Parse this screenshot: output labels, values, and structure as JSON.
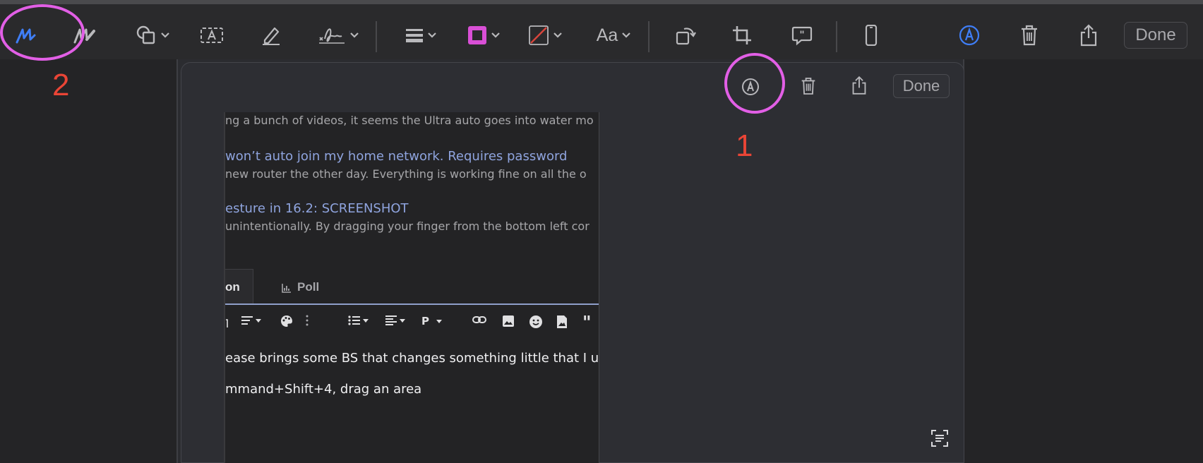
{
  "toolbar": {
    "done_label": "Done",
    "tools": [
      {
        "name": "sketch-tool",
        "icon": "sketch-icon",
        "active": true
      },
      {
        "name": "draw-tool",
        "icon": "draw-icon"
      },
      {
        "name": "shapes-tool",
        "icon": "shapes-icon"
      },
      {
        "name": "text-tool",
        "icon": "text-box-icon"
      },
      {
        "name": "highlight-tool",
        "icon": "highlighter-icon"
      },
      {
        "name": "sign-tool",
        "icon": "signature-icon"
      },
      {
        "name": "shape-style-tool",
        "icon": "line-weight-icon"
      },
      {
        "name": "border-color-tool",
        "icon": "border-color-icon",
        "color": "#d94fd6"
      },
      {
        "name": "fill-color-tool",
        "icon": "fill-color-icon",
        "color": "#d8453c"
      },
      {
        "name": "text-style-tool",
        "icon": "text-style-icon",
        "label": "Aa"
      },
      {
        "name": "rotate-tool",
        "icon": "rotate-icon"
      },
      {
        "name": "crop-tool",
        "icon": "crop-icon"
      },
      {
        "name": "description-tool",
        "icon": "quote-bubble-icon"
      },
      {
        "name": "device-frame-tool",
        "icon": "phone-icon"
      },
      {
        "name": "markup-button",
        "icon": "markup-pen-icon",
        "color": "#3f7ef6"
      },
      {
        "name": "trash-button",
        "icon": "trash-icon"
      },
      {
        "name": "share-button",
        "icon": "share-icon"
      }
    ]
  },
  "annotations": {
    "label_1": "1",
    "label_2": "2",
    "ring_color": "#e25fe6",
    "number_color": "#ea4536"
  },
  "inner": {
    "done_label": "Done",
    "snippets": [
      {
        "text": "ng a bunch of videos, it seems the Ultra auto goes into water mo",
        "kind": "snippet"
      },
      {
        "text": " won’t auto join my home network. Requires password",
        "kind": "link"
      },
      {
        "text": "new router the other day. Everything is working fine on all the o",
        "kind": "snippet"
      },
      {
        "text": "esture in 16.2: SCREENSHOT",
        "kind": "link"
      },
      {
        "text": "unintentionally. By dragging your finger from the bottom left cor",
        "kind": "snippet"
      }
    ],
    "tabs": {
      "active": "on",
      "poll": "Poll"
    },
    "editor_icons": [
      "paragraph-align-icon",
      "palette-icon",
      "more-icon",
      "list-icon",
      "align-icon",
      "paragraph-icon",
      "link-icon",
      "image-icon",
      "emoji-icon",
      "media-icon",
      "quote-icon"
    ],
    "paragraph_label": "P",
    "body_lines": [
      "ease brings some BS that changes something little that I us",
      "mmand+Shift+4, drag an area"
    ]
  }
}
